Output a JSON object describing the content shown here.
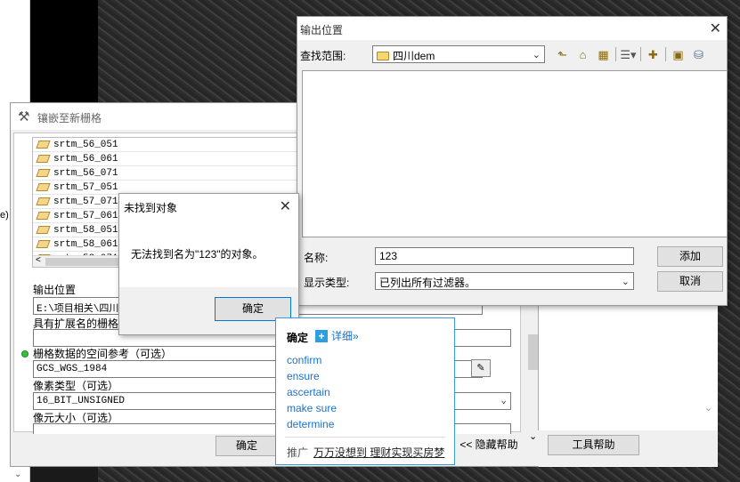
{
  "background": {
    "left_edge_text": "e)",
    "left_edge_arrow": "⌄"
  },
  "mosaic_dialog": {
    "title": "镶嵌至新栅格",
    "input_rasters": [
      "srtm_56_051",
      "srtm_56_061",
      "srtm_56_071",
      "srtm_57_051",
      "srtm_57_071",
      "srtm_57_061",
      "srtm_58_051",
      "srtm_58_061",
      "srtm_58_071"
    ],
    "output_location_label": "输出位置",
    "output_location_value": "E:\\项目相关\\四川阿",
    "raster_name_label": "具有扩展名的栅格数",
    "raster_name_value": "",
    "spatial_ref_label": "栅格数据的空间参考（可选）",
    "spatial_ref_value": "GCS_WGS_1984",
    "pixel_type_label": "像素类型（可选）",
    "pixel_type_value": "16_BIT_UNSIGNED",
    "cell_size_label": "像元大小（可选）",
    "ok_label": "确定",
    "hide_help_label": "<< 隐藏帮助",
    "tool_help_label": "工具帮助"
  },
  "output_location_dialog": {
    "title": "输出位置",
    "look_in_label": "查找范围:",
    "look_in_value": "四川dem",
    "name_label": "名称:",
    "name_value": "123",
    "type_label": "显示类型:",
    "type_value": "已列出所有过滤器。",
    "add_label": "添加",
    "cancel_label": "取消"
  },
  "not_found_dialog": {
    "title": "未找到对象",
    "message": "无法找到名为\"123\"的对象。",
    "ok_label": "确定"
  },
  "dictionary_popup": {
    "word": "确定",
    "more_label": "详细»",
    "definitions": [
      "confirm",
      "ensure",
      "ascertain",
      "make sure",
      "determine"
    ],
    "ad_prefix": "推广",
    "ad_text": "万万没想到 理财实现买房梦"
  }
}
